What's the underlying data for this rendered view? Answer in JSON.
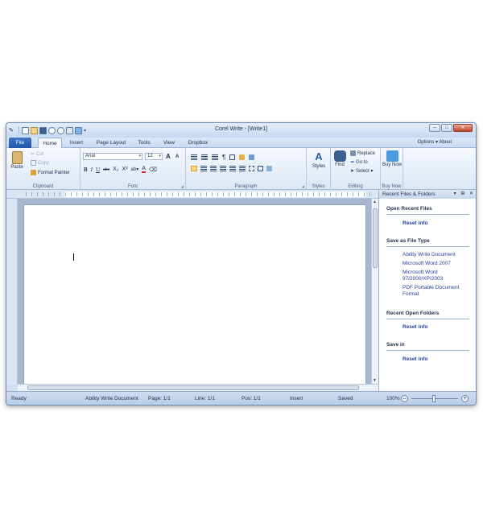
{
  "window": {
    "title": "Corel Write - [Write1]"
  },
  "tabs": {
    "file": "File",
    "items": [
      "Home",
      "Insert",
      "Page Layout",
      "Tools",
      "View",
      "Dropbox"
    ],
    "options": "Options ▾ About"
  },
  "ribbon": {
    "clipboard": {
      "label": "Clipboard",
      "paste": "Paste",
      "cut": "Cut",
      "copy": "Copy",
      "format_painter": "Format Painter"
    },
    "font": {
      "label": "Font",
      "font_name": "Arial",
      "font_size": "12"
    },
    "paragraph": {
      "label": "Paragraph"
    },
    "styles": {
      "label": "Styles",
      "button": "Styles"
    },
    "editing": {
      "label": "Editing",
      "find": "Find",
      "replace": "Replace",
      "goto": "Go to",
      "select": "Select ▾"
    },
    "buy": {
      "label": "Buy Now",
      "button": "Buy Now"
    }
  },
  "pane": {
    "title": "Recent Files & Folders",
    "open_recent": {
      "heading": "Open Recent Files",
      "reset": "Reset info"
    },
    "save_type": {
      "heading": "Save as File Type",
      "items": [
        "Ability Write Document",
        "Microsoft Word 2007",
        "Microsoft Word 97/2000/XP/2003",
        "PDF Portable Document Format"
      ]
    },
    "recent_folders": {
      "heading": "Recent Open Folders",
      "reset": "Reset info"
    },
    "save_in": {
      "heading": "Save in",
      "reset": "Reset info"
    }
  },
  "status": {
    "state": "Ready",
    "doctype": "Ability Write Document",
    "page": "Page: 1/1",
    "line": "Line: 1/1",
    "pos": "Pos: 1/1",
    "mode": "Insert",
    "saved": "Saved",
    "zoom": "100%"
  },
  "colors": {
    "accent": "#1f58ad",
    "link": "#24409c",
    "select_highlight": "#ffd77a"
  }
}
